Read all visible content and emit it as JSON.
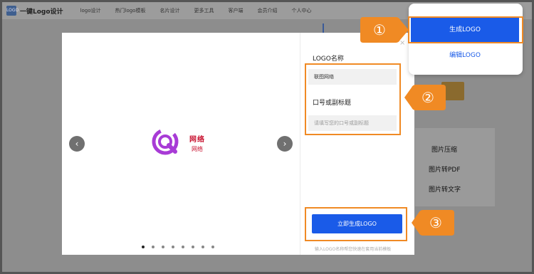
{
  "topbar": {
    "logo_text": "LOGO",
    "site_name": "一键Logo设计",
    "nav": [
      "logo设计",
      "热门logo模板",
      "名片设计",
      "更多工具",
      "客户端",
      "会员介绍",
      "个人中心"
    ]
  },
  "background": {
    "tools": [
      "图片压缩",
      "图片转PDF",
      "图片转文字"
    ]
  },
  "modal": {
    "close": "×",
    "prev": "‹",
    "next": "›",
    "preview": {
      "title": "网络",
      "subtitle": "网络"
    },
    "dots_count": 8,
    "name_label": "LOGO名称",
    "name_value": "联图网络",
    "slogan_label": "口号或副标题",
    "slogan_placeholder": "请填写您的口号或副标题",
    "generate_button": "立即生成LOGO",
    "hint": "输入LOGO名称帮您快速在套用当前模板"
  },
  "dropdown": {
    "primary": "生成LOGO",
    "secondary": "编辑LOGO"
  },
  "callouts": [
    "①",
    "②",
    "③"
  ],
  "colors": {
    "accent": "#1a5be8",
    "annotation": "#f08a24",
    "preview_purple": "#a83bd6",
    "preview_red": "#c8102e"
  }
}
